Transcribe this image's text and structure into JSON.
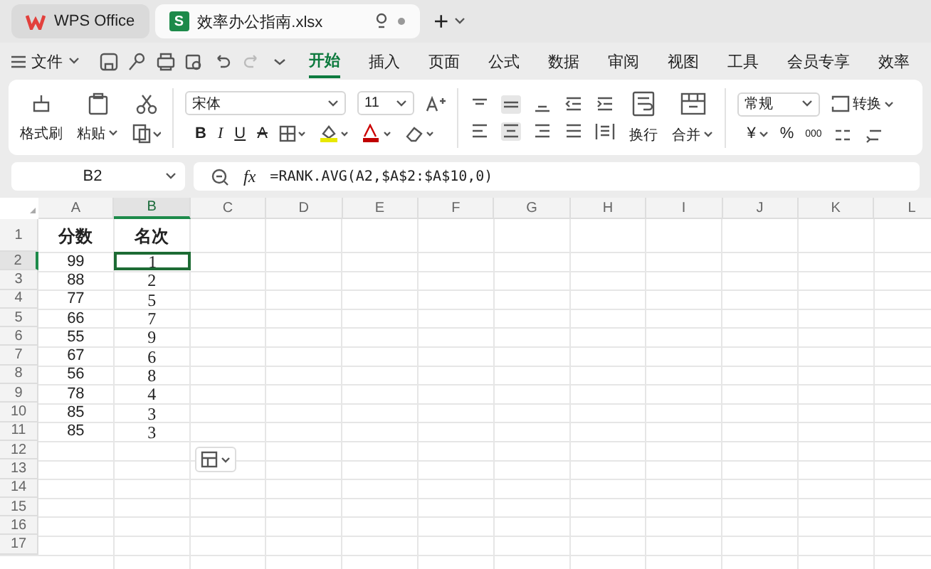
{
  "tabs": [
    {
      "label": "WPS Office",
      "kind": "home",
      "selected": false
    },
    {
      "label": "效率办公指南.xlsx",
      "kind": "sheet",
      "badge": "S",
      "selected": true
    }
  ],
  "new_tab": "+",
  "menu": {
    "file": "文件",
    "tabs": [
      {
        "label": "开始",
        "selected": true
      },
      {
        "label": "插入",
        "selected": false
      },
      {
        "label": "页面",
        "selected": false
      },
      {
        "label": "公式",
        "selected": false
      },
      {
        "label": "数据",
        "selected": false
      },
      {
        "label": "审阅",
        "selected": false
      },
      {
        "label": "视图",
        "selected": false
      },
      {
        "label": "工具",
        "selected": false
      },
      {
        "label": "会员专享",
        "selected": false
      },
      {
        "label": "效率",
        "selected": false
      }
    ]
  },
  "ribbon": {
    "format_painter": "格式刷",
    "paste": "粘贴",
    "font": "宋体",
    "font_size": "11",
    "bold": "B",
    "italic": "I",
    "underline": "U",
    "strike": "A",
    "wrap": "换行",
    "merge": "合并",
    "number_format": "常规",
    "convert": "转换",
    "currency": "¥",
    "percent": "%",
    "thousands": "000"
  },
  "formula_bar": {
    "cell": "B2",
    "fx": "fx",
    "formula": "=RANK.AVG(A2,$A$2:$A$10,0)"
  },
  "sheet": {
    "columns": [
      {
        "label": "A",
        "selected": false
      },
      {
        "label": "B",
        "selected": true
      },
      {
        "label": "C",
        "selected": false
      },
      {
        "label": "D",
        "selected": false
      },
      {
        "label": "E",
        "selected": false
      },
      {
        "label": "F",
        "selected": false
      },
      {
        "label": "G",
        "selected": false
      },
      {
        "label": "H",
        "selected": false
      },
      {
        "label": "I",
        "selected": false
      },
      {
        "label": "J",
        "selected": false
      },
      {
        "label": "K",
        "selected": false
      },
      {
        "label": "L",
        "selected": false
      }
    ],
    "rows": [
      {
        "number": "1",
        "selected": false,
        "cells": [
          {
            "text": "分数",
            "selected": false
          },
          {
            "text": "名次",
            "selected": false
          }
        ]
      },
      {
        "number": "2",
        "selected": true,
        "cells": [
          {
            "text": "99",
            "selected": false
          },
          {
            "text": "1",
            "selected": true
          }
        ]
      },
      {
        "number": "3",
        "selected": false,
        "cells": [
          {
            "text": "88",
            "selected": false
          },
          {
            "text": "2",
            "selected": false
          }
        ]
      },
      {
        "number": "4",
        "selected": false,
        "cells": [
          {
            "text": "77",
            "selected": false
          },
          {
            "text": "5",
            "selected": false
          }
        ]
      },
      {
        "number": "5",
        "selected": false,
        "cells": [
          {
            "text": "66",
            "selected": false
          },
          {
            "text": "7",
            "selected": false
          }
        ]
      },
      {
        "number": "6",
        "selected": false,
        "cells": [
          {
            "text": "55",
            "selected": false
          },
          {
            "text": "9",
            "selected": false
          }
        ]
      },
      {
        "number": "7",
        "selected": false,
        "cells": [
          {
            "text": "67",
            "selected": false
          },
          {
            "text": "6",
            "selected": false
          }
        ]
      },
      {
        "number": "8",
        "selected": false,
        "cells": [
          {
            "text": "56",
            "selected": false
          },
          {
            "text": "8",
            "selected": false
          }
        ]
      },
      {
        "number": "9",
        "selected": false,
        "cells": [
          {
            "text": "78",
            "selected": false
          },
          {
            "text": "4",
            "selected": false
          }
        ]
      },
      {
        "number": "10",
        "selected": false,
        "cells": [
          {
            "text": "85",
            "selected": false
          },
          {
            "text": "3",
            "selected": false
          }
        ]
      },
      {
        "number": "11",
        "selected": false,
        "cells": [
          {
            "text": "85",
            "selected": false
          },
          {
            "text": "3",
            "selected": false
          }
        ]
      },
      {
        "number": "12",
        "selected": false,
        "cells": []
      },
      {
        "number": "13",
        "selected": false,
        "cells": []
      },
      {
        "number": "14",
        "selected": false,
        "cells": []
      },
      {
        "number": "15",
        "selected": false,
        "cells": []
      },
      {
        "number": "16",
        "selected": false,
        "cells": []
      },
      {
        "number": "17",
        "selected": false,
        "cells": []
      }
    ]
  }
}
